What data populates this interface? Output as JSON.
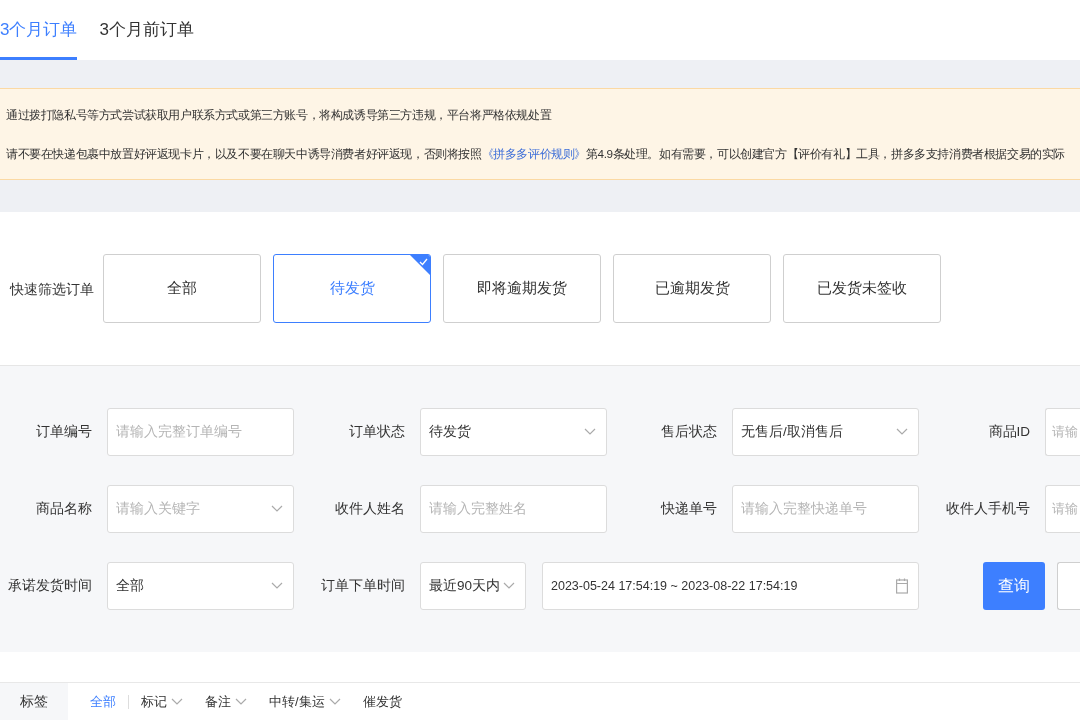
{
  "tabs": [
    {
      "label": "3个月订单",
      "selected": true
    },
    {
      "label": "3个月前订单",
      "selected": false
    }
  ],
  "notice": {
    "lines": [
      {
        "text": "通过拨打隐私号等方式尝试获取用户联系方式或第三方账号，将构成诱导第三方违规，平台将严格依规处置"
      },
      {
        "text": "请不要在快递包裹中放置好评返现卡片，以及不要在聊天中诱导消费者好评返现，否则将按照",
        "link": "《拼多多评价规则》",
        "after": "第4.9条处理。如有需要，可以创建官方【评价有礼】工具，拼多多支持消费者根据交易的实际"
      }
    ]
  },
  "quick_filter": {
    "label": "快速筛选订单",
    "options": [
      {
        "label": "全部",
        "selected": false
      },
      {
        "label": "待发货",
        "selected": true
      },
      {
        "label": "即将逾期发货",
        "selected": false
      },
      {
        "label": "已逾期发货",
        "selected": false
      },
      {
        "label": "已发货未签收",
        "selected": false
      }
    ]
  },
  "form": {
    "rows": [
      [
        {
          "label": "订单编号",
          "kind": "input",
          "placeholder": "请输入完整订单编号"
        },
        {
          "label": "订单状态",
          "kind": "select",
          "value": "待发货"
        },
        {
          "label": "售后状态",
          "kind": "select",
          "value": "无售后/取消售后"
        },
        {
          "label": "商品ID",
          "kind": "input",
          "placeholder": "请输"
        }
      ],
      [
        {
          "label": "商品名称",
          "kind": "select",
          "placeholder": "请输入关键字"
        },
        {
          "label": "收件人姓名",
          "kind": "input",
          "placeholder": "请输入完整姓名"
        },
        {
          "label": "快递单号",
          "kind": "input",
          "placeholder": "请输入完整快递单号"
        },
        {
          "label": "收件人手机号",
          "kind": "input",
          "placeholder": "请输"
        }
      ],
      [
        {
          "label": "承诺发货时间",
          "kind": "select",
          "value": "全部"
        },
        {
          "label": "订单下单时间",
          "kind": "select",
          "value": "最近90天内"
        },
        {
          "kind": "daterange",
          "value": "2023-05-24 17:54:19 ~ 2023-08-22 17:54:19"
        }
      ]
    ],
    "query_button": "查询"
  },
  "tag_bar": {
    "label": "标签",
    "items": [
      {
        "label": "全部",
        "selected": true,
        "dropdown": false
      },
      {
        "label": "标记",
        "selected": false,
        "dropdown": true
      },
      {
        "label": "备注",
        "selected": false,
        "dropdown": true
      },
      {
        "label": "中转/集运",
        "selected": false,
        "dropdown": true
      },
      {
        "label": "催发货",
        "selected": false,
        "dropdown": false
      }
    ]
  }
}
